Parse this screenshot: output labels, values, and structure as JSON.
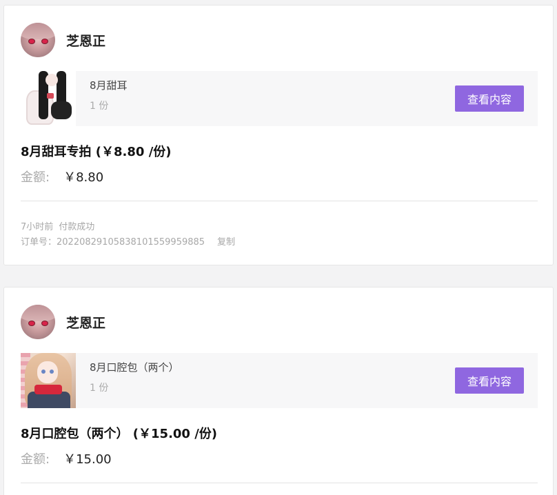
{
  "orders": [
    {
      "seller_name": "芝恩正",
      "item_title": "8月甜耳",
      "item_qty": "1 份",
      "view_button": "查看内容",
      "order_title": "8月甜耳专拍  (￥8.80 /份)",
      "amount_label": "金额:",
      "amount_value": "￥8.80",
      "time": "7小时前",
      "status": "付款成功",
      "order_no": "订单号：20220829105838101559959885",
      "copy_label": "复制"
    },
    {
      "seller_name": "芝恩正",
      "item_title": "8月口腔包（两个）",
      "item_qty": "1 份",
      "view_button": "查看内容",
      "order_title": "8月口腔包（两个）  (￥15.00 /份)",
      "amount_label": "金额:",
      "amount_value": "￥15.00"
    }
  ],
  "colors": {
    "accent": "#8f67e0",
    "background": "#f3f3f4",
    "card": "#ffffff",
    "muted_text": "#aaaaaa"
  }
}
